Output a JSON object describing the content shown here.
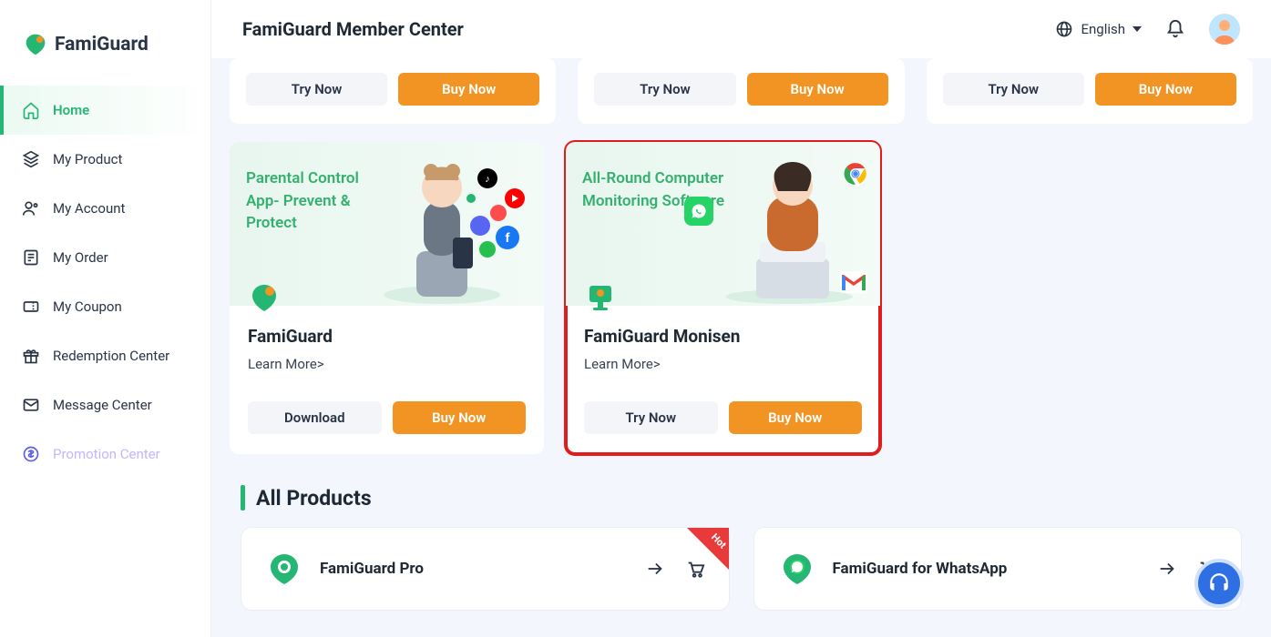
{
  "brand": {
    "name": "FamiGuard"
  },
  "header": {
    "title": "FamiGuard Member Center",
    "language": "English"
  },
  "sidebar": {
    "items": [
      {
        "label": "Home",
        "icon": "home-icon",
        "active": true
      },
      {
        "label": "My Product",
        "icon": "layers-icon"
      },
      {
        "label": "My Account",
        "icon": "user-icon"
      },
      {
        "label": "My Order",
        "icon": "order-icon"
      },
      {
        "label": "My Coupon",
        "icon": "coupon-icon"
      },
      {
        "label": "Redemption Center",
        "icon": "gift-icon"
      },
      {
        "label": "Message Center",
        "icon": "mail-icon"
      },
      {
        "label": "Promotion Center",
        "icon": "dollar-icon",
        "promo": true
      }
    ]
  },
  "top_cards": [
    {
      "try": "Try Now",
      "buy": "Buy Now"
    },
    {
      "try": "Try Now",
      "buy": "Buy Now"
    },
    {
      "try": "Try Now",
      "buy": "Buy Now"
    }
  ],
  "featured": [
    {
      "hero_text": "Parental Control App- Prevent & Protect",
      "title": "FamiGuard",
      "learn": "Learn More>",
      "secondary": "Download",
      "primary": "Buy Now",
      "highlight": false
    },
    {
      "hero_text": "All-Round Computer Monitoring Software",
      "title": "FamiGuard Monisen",
      "learn": "Learn More>",
      "secondary": "Try Now",
      "primary": "Buy Now",
      "highlight": true
    }
  ],
  "section": {
    "title": "All Products"
  },
  "all_products": [
    {
      "title": "FamiGuard Pro",
      "hot": true
    },
    {
      "title": "FamiGuard for WhatsApp",
      "hot": false
    }
  ],
  "hot_label": "Hot"
}
